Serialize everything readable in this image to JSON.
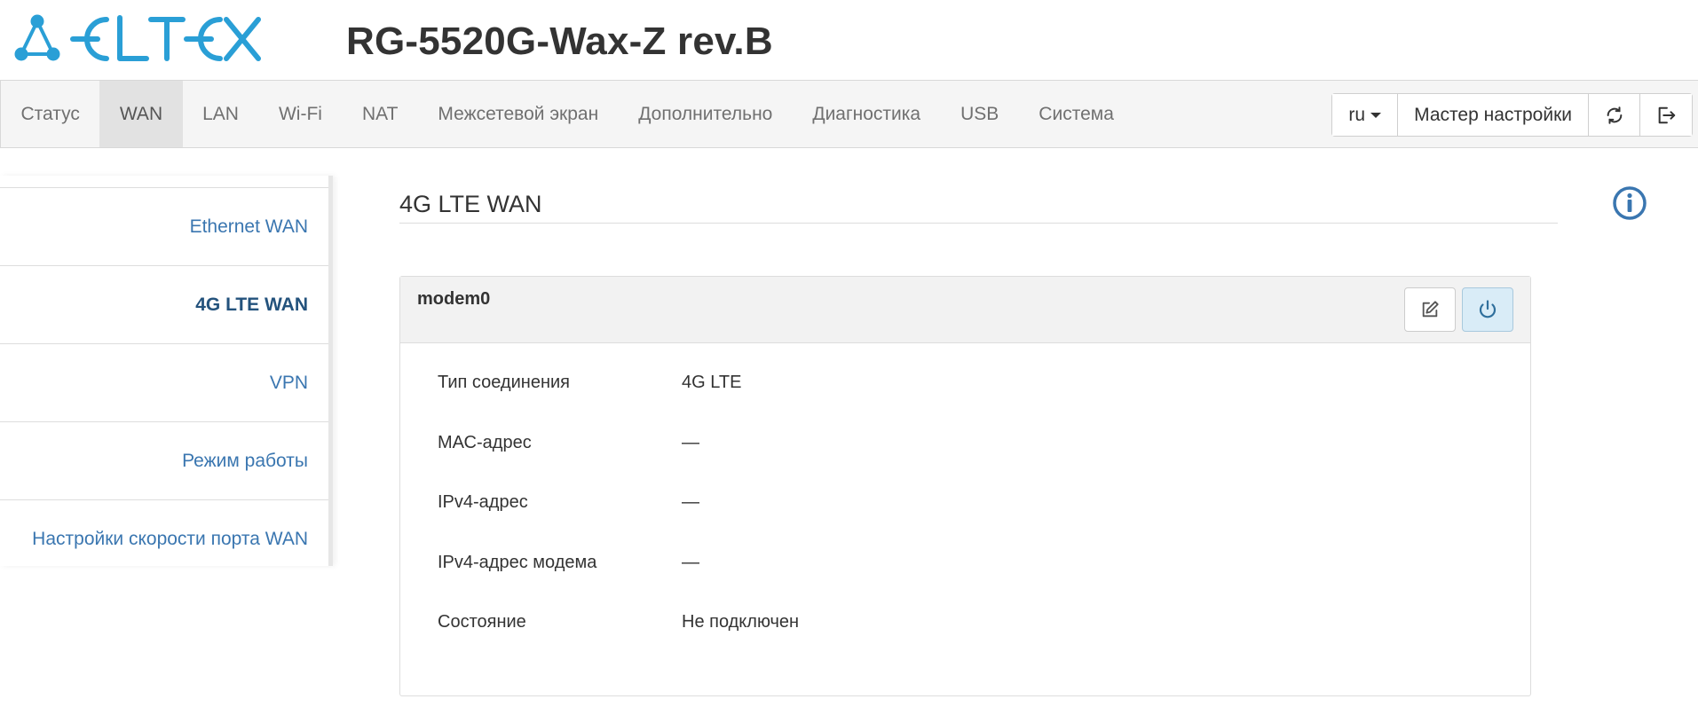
{
  "header": {
    "logo_text": "ELTEX",
    "device_title": "RG-5520G-Wax-Z rev.B"
  },
  "navbar": {
    "items": [
      {
        "label": "Статус"
      },
      {
        "label": "WAN"
      },
      {
        "label": "LAN"
      },
      {
        "label": "Wi-Fi"
      },
      {
        "label": "NAT"
      },
      {
        "label": "Межсетевой экран"
      },
      {
        "label": "Дополнительно"
      },
      {
        "label": "Диагностика"
      },
      {
        "label": "USB"
      },
      {
        "label": "Система"
      }
    ],
    "active_item": "WAN",
    "language": "ru",
    "wizard_label": "Мастер настройки",
    "refresh_icon": "refresh-icon",
    "logout_icon": "logout-icon"
  },
  "sidebar": {
    "items": [
      {
        "label": "Ethernet WAN"
      },
      {
        "label": "4G LTE WAN"
      },
      {
        "label": "VPN"
      },
      {
        "label": "Режим работы"
      },
      {
        "label": "Настройки скорости порта WAN"
      }
    ],
    "active_item": "4G LTE WAN"
  },
  "main": {
    "heading": "4G LTE WAN",
    "info_icon": "info-icon",
    "panel": {
      "title": "modem0",
      "edit_icon": "edit-icon",
      "power_icon": "power-icon",
      "rows": [
        {
          "label": "Тип соединения",
          "value": "4G LTE"
        },
        {
          "label": "МАС-адрес",
          "value": "—"
        },
        {
          "label": "IPv4-адрес",
          "value": "—"
        },
        {
          "label": "IPv4-адрес модема",
          "value": "—"
        },
        {
          "label": "Состояние",
          "value": "Не подключен"
        }
      ]
    }
  },
  "colors": {
    "brand": "#2a9fd6",
    "link": "#3a76b0",
    "link_active": "#23527c",
    "nav_active_bg": "#e2e2e2",
    "power_btn_bg": "#d9ecf7"
  }
}
